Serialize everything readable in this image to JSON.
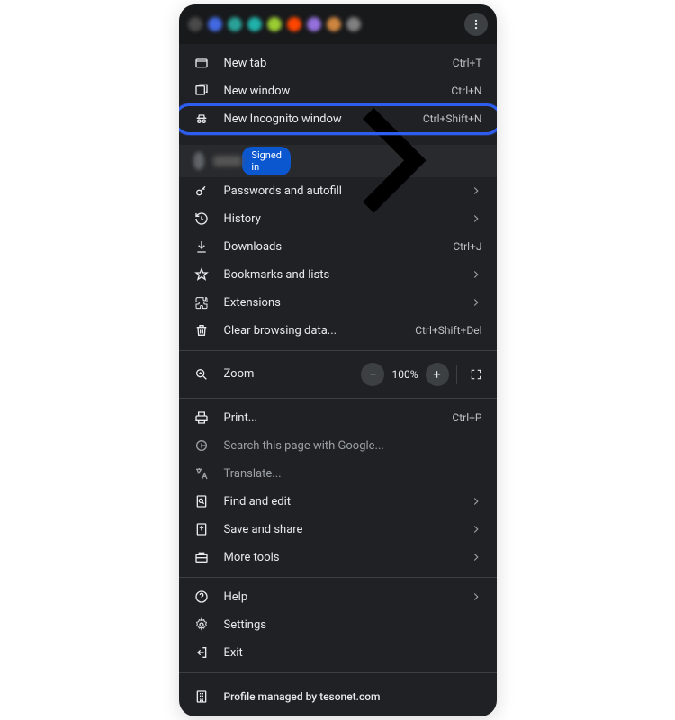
{
  "menu": {
    "new_tab": {
      "label": "New tab",
      "shortcut": "Ctrl+T"
    },
    "new_window": {
      "label": "New window",
      "shortcut": "Ctrl+N"
    },
    "new_incognito": {
      "label": "New Incognito window",
      "shortcut": "Ctrl+Shift+N"
    },
    "profile": {
      "signed_in": "Signed in"
    },
    "passwords": {
      "label": "Passwords and autofill"
    },
    "history": {
      "label": "History"
    },
    "downloads": {
      "label": "Downloads",
      "shortcut": "Ctrl+J"
    },
    "bookmarks": {
      "label": "Bookmarks and lists"
    },
    "extensions": {
      "label": "Extensions"
    },
    "clear_data": {
      "label": "Clear browsing data...",
      "shortcut": "Ctrl+Shift+Del"
    },
    "zoom": {
      "label": "Zoom",
      "value": "100%"
    },
    "print": {
      "label": "Print...",
      "shortcut": "Ctrl+P"
    },
    "search_page": {
      "label": "Search this page with Google..."
    },
    "translate": {
      "label": "Translate..."
    },
    "find": {
      "label": "Find and edit"
    },
    "save_share": {
      "label": "Save and share"
    },
    "more_tools": {
      "label": "More tools"
    },
    "help": {
      "label": "Help"
    },
    "settings": {
      "label": "Settings"
    },
    "exit": {
      "label": "Exit"
    },
    "managed": {
      "label": "Profile managed by tesonet.com"
    }
  },
  "highlight_color": "#2e5ef0"
}
